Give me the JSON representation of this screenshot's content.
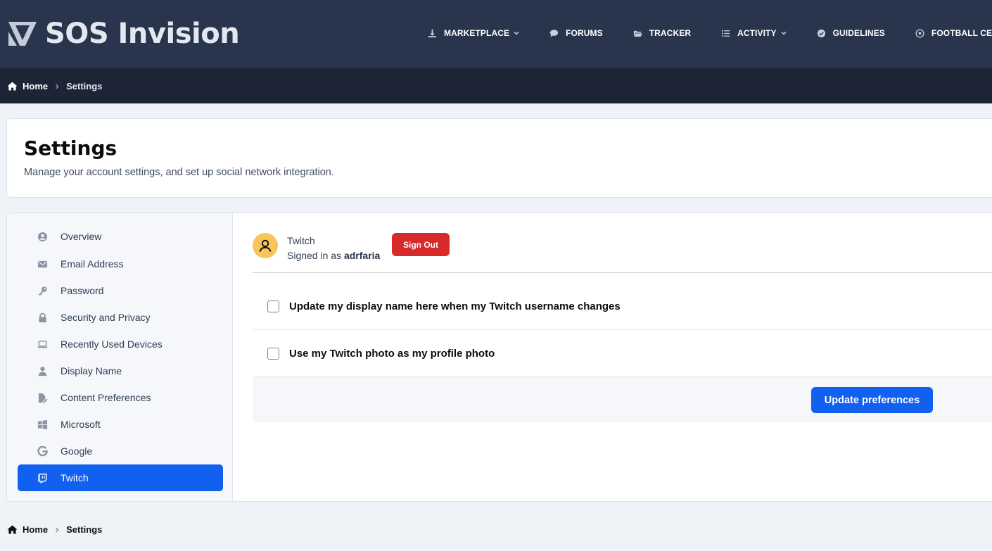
{
  "brand": {
    "name": "SOS Invision"
  },
  "nav": {
    "items": [
      {
        "label": "MARKETPLACE",
        "icon": "download-icon",
        "dropdown": true
      },
      {
        "label": "FORUMS",
        "icon": "chat-bubble-icon",
        "dropdown": false
      },
      {
        "label": "TRACKER",
        "icon": "folder-open-icon",
        "dropdown": false
      },
      {
        "label": "ACTIVITY",
        "icon": "list-icon",
        "dropdown": true
      },
      {
        "label": "GUIDELINES",
        "icon": "check-circle-icon",
        "dropdown": false
      },
      {
        "label": "FOOTBALL CEN",
        "icon": "football-icon",
        "dropdown": false
      }
    ]
  },
  "breadcrumb": {
    "home": "Home",
    "current": "Settings"
  },
  "page": {
    "title": "Settings",
    "subtitle": "Manage your account settings, and set up social network integration."
  },
  "sidebar": {
    "items": [
      {
        "label": "Overview",
        "icon": "user-circle-icon",
        "active": false
      },
      {
        "label": "Email Address",
        "icon": "envelope-icon",
        "active": false
      },
      {
        "label": "Password",
        "icon": "key-icon",
        "active": false
      },
      {
        "label": "Security and Privacy",
        "icon": "lock-icon",
        "active": false
      },
      {
        "label": "Recently Used Devices",
        "icon": "laptop-icon",
        "active": false
      },
      {
        "label": "Display Name",
        "icon": "user-icon",
        "active": false
      },
      {
        "label": "Content Preferences",
        "icon": "file-edit-icon",
        "active": false
      },
      {
        "label": "Microsoft",
        "icon": "windows-icon",
        "active": false
      },
      {
        "label": "Google",
        "icon": "google-icon",
        "active": false
      },
      {
        "label": "Twitch",
        "icon": "twitch-icon",
        "active": true
      }
    ]
  },
  "account": {
    "service": "Twitch",
    "signed_in_prefix": "Signed in as",
    "username": "adrfaria",
    "sign_out_label": "Sign Out"
  },
  "options": [
    {
      "label": "Update my display name here when my Twitch username changes",
      "checked": false
    },
    {
      "label": "Use my Twitch photo as my profile photo",
      "checked": false
    }
  ],
  "actions": {
    "update_label": "Update preferences"
  },
  "colors": {
    "header_bg": "#28354d",
    "breadcrumb_bg": "#1c2435",
    "accent": "#1160f0",
    "danger": "#d8292b",
    "avatar_bg": "#f7c65a"
  }
}
